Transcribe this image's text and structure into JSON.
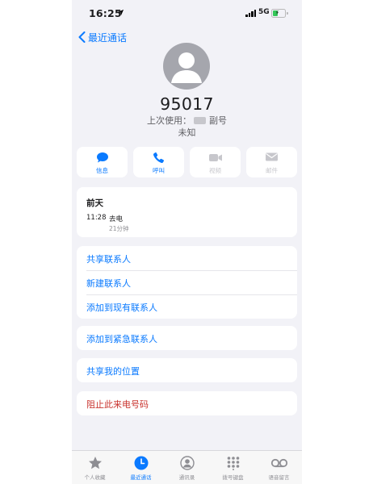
{
  "status_bar": {
    "time": "16:25",
    "network": "5G",
    "battery_level": 0.4
  },
  "nav": {
    "back_label": "最近通话"
  },
  "contact": {
    "number": "95017",
    "last_used_prefix": "上次使用：",
    "last_used_line": "副号",
    "status": "未知"
  },
  "actions": [
    {
      "label": "信息",
      "icon": "message-bubble-icon",
      "enabled": true
    },
    {
      "label": "呼叫",
      "icon": "phone-icon",
      "enabled": true
    },
    {
      "label": "视频",
      "icon": "video-icon",
      "enabled": false
    },
    {
      "label": "邮件",
      "icon": "envelope-icon",
      "enabled": false
    }
  ],
  "call_history": {
    "day": "前天",
    "time": "11:28",
    "type": "去电",
    "duration": "21分钟"
  },
  "contact_options": [
    "共享联系人",
    "新建联系人",
    "添加到现有联系人"
  ],
  "emergency": {
    "label": "添加到紧急联系人"
  },
  "location": {
    "label": "共享我的位置"
  },
  "block": {
    "label": "阻止此来电号码"
  },
  "tab_bar": [
    {
      "label": "个人收藏",
      "icon": "star-icon",
      "active": false
    },
    {
      "label": "最近通话",
      "icon": "clock-icon",
      "active": true
    },
    {
      "label": "通讯录",
      "icon": "contacts-icon",
      "active": false
    },
    {
      "label": "拨号键盘",
      "icon": "keypad-icon",
      "active": false
    },
    {
      "label": "语音留言",
      "icon": "voicemail-icon",
      "active": false
    }
  ],
  "colors": {
    "accent": "#0a7aff",
    "destructive": "#c8322d",
    "background": "#f2f2f7",
    "battery": "#34c759"
  }
}
